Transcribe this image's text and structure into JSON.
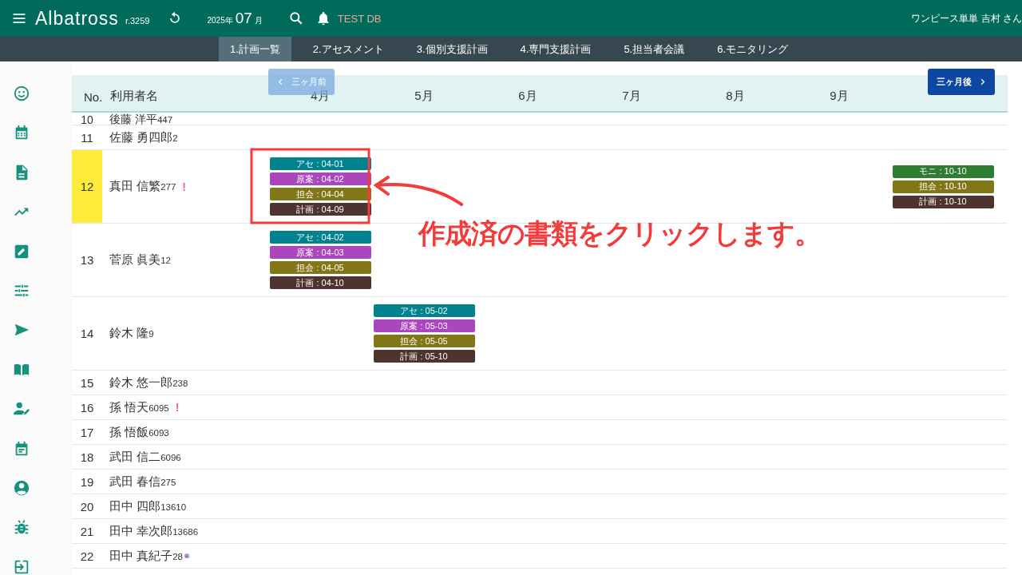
{
  "topbar": {
    "app_name": "Albatross",
    "revision": "r.3259",
    "year": "2025年",
    "month": "07",
    "month_unit": "月",
    "database": "TEST DB",
    "user": "ワンピース単単 吉村 さん"
  },
  "tabs": [
    {
      "label": "1.計画一覧",
      "selected": true
    },
    {
      "label": "2.アセスメント",
      "selected": false
    },
    {
      "label": "3.個別支援計画",
      "selected": false
    },
    {
      "label": "4.専門支援計画",
      "selected": false
    },
    {
      "label": "5.担当者会議",
      "selected": false
    },
    {
      "label": "6.モニタリング",
      "selected": false
    }
  ],
  "table": {
    "columns": [
      "No.",
      "利用者名",
      "4月",
      "5月",
      "6月",
      "7月",
      "8月",
      "9月"
    ],
    "prev_button": "三ヶ月前",
    "next_button": "三ヶ月後",
    "rows": [
      {
        "no": "10",
        "name": "後藤 洋平",
        "code": "447",
        "selected": false,
        "note_icon": false
      },
      {
        "no": "11",
        "name": "佐藤 勇四郎",
        "code": "2",
        "selected": false,
        "note_icon": false
      },
      {
        "no": "12",
        "name": "真田 信繁",
        "code": "277",
        "selected": true,
        "alert": "!",
        "note_icon": false,
        "plans": [
          {
            "kind": "apr",
            "chips": [
              {
                "kind": "assess",
                "label": "アセ : 04-01"
              },
              {
                "kind": "draft",
                "label": "原案 : 04-02"
              },
              {
                "kind": "meeting",
                "label": "担会 : 04-04"
              },
              {
                "kind": "plan",
                "label": "計画 : 04-09"
              }
            ]
          },
          {
            "kind": "oct",
            "chips": [
              {
                "kind": "monitor",
                "label": "モニ : 10-10"
              },
              {
                "kind": "meeting",
                "label": "担会 : 10-10"
              },
              {
                "kind": "plan",
                "label": "計画 : 10-10"
              }
            ]
          }
        ]
      },
      {
        "no": "13",
        "name": "菅原 眞美",
        "code": "12",
        "selected": false,
        "note_icon": false,
        "plans": [
          {
            "kind": "apr",
            "chips": [
              {
                "kind": "assess",
                "label": "アセ : 04-02"
              },
              {
                "kind": "draft",
                "label": "原案 : 04-03"
              },
              {
                "kind": "meeting",
                "label": "担会 : 04-05"
              },
              {
                "kind": "plan",
                "label": "計画 : 04-10"
              }
            ]
          }
        ]
      },
      {
        "no": "14",
        "name": "鈴木 隆",
        "code": "9",
        "selected": false,
        "note_icon": false,
        "plans": [
          {
            "kind": "may",
            "chips": [
              {
                "kind": "assess",
                "label": "アセ : 05-02"
              },
              {
                "kind": "draft",
                "label": "原案 : 05-03"
              },
              {
                "kind": "meeting",
                "label": "担会 : 05-05"
              },
              {
                "kind": "plan",
                "label": "計画 : 05-10"
              }
            ]
          }
        ]
      },
      {
        "no": "15",
        "name": "鈴木 悠一郎",
        "code": "238",
        "selected": false,
        "note_icon": false
      },
      {
        "no": "16",
        "name": "孫 悟天",
        "code": "6095",
        "selected": false,
        "alert": "!",
        "note_icon": false
      },
      {
        "no": "17",
        "name": "孫 悟飯",
        "code": "6093",
        "selected": false,
        "note_icon": false
      },
      {
        "no": "18",
        "name": "武田 信二",
        "code": "6096",
        "selected": false,
        "note_icon": false
      },
      {
        "no": "19",
        "name": "武田 春信",
        "code": "275",
        "selected": false,
        "note_icon": false
      },
      {
        "no": "20",
        "name": "田中 四郎",
        "code": "13610",
        "selected": false,
        "note_icon": false
      },
      {
        "no": "21",
        "name": "田中 幸次郎",
        "code": "13686",
        "selected": false,
        "note_icon": false
      },
      {
        "no": "22",
        "name": "田中 真紀子",
        "code": "28",
        "selected": false,
        "note_icon": true
      }
    ]
  },
  "annotation": {
    "text": "作成済の書類をクリックします。"
  }
}
